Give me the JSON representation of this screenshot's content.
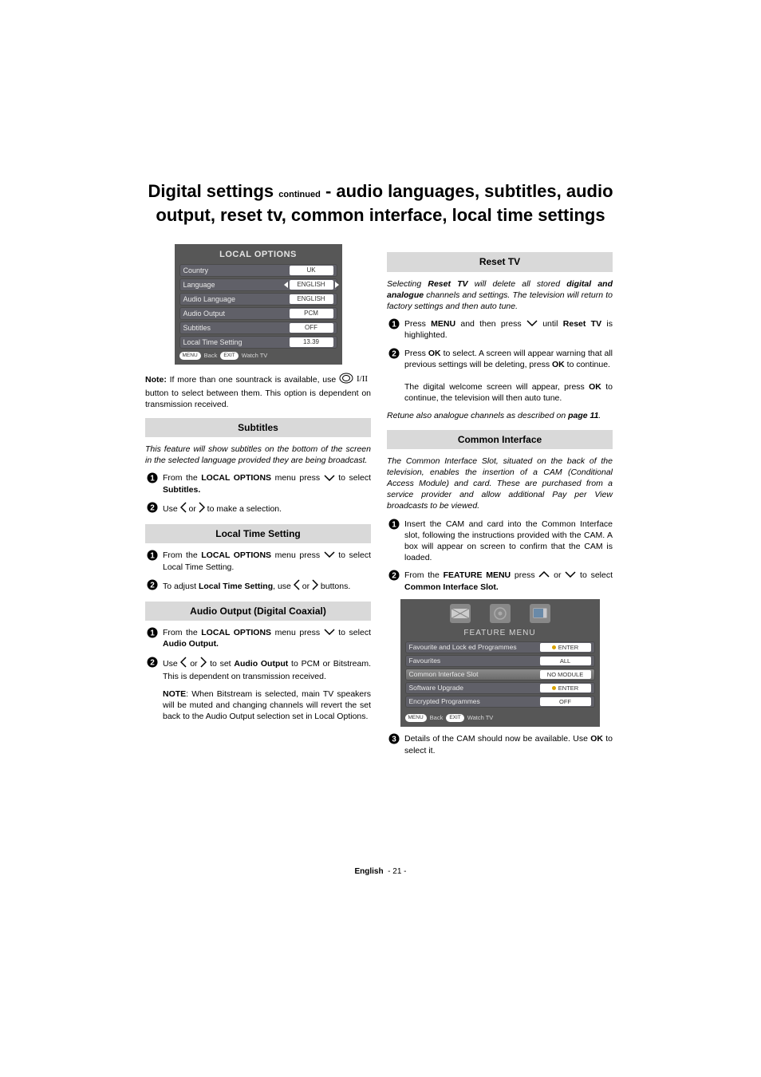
{
  "title_part1": "Digital settings",
  "title_cont": "continued",
  "title_part2": " - audio languages, subtitles, audio output, reset tv, common interface, local time settings",
  "local_options": {
    "title": "LOCAL OPTIONS",
    "rows": [
      {
        "label": "Country",
        "value": "UK"
      },
      {
        "label": "Language",
        "value": "ENGLISH",
        "selected": true
      },
      {
        "label": "Audio Language",
        "value": "ENGLISH"
      },
      {
        "label": "Audio Output",
        "value": "PCM"
      },
      {
        "label": "Subtitles",
        "value": "OFF"
      },
      {
        "label": "Local Time Setting",
        "value": "13.39"
      }
    ],
    "footer_menu": "MENU",
    "footer_back": "Back",
    "footer_exit": "EXIT",
    "footer_watch": "Watch TV"
  },
  "note1_prefix": "Note:",
  "note1_a": " If more than one sountrack is available, use ",
  "note1_b": " button to select between them. This option is dependent on transmission received.",
  "subtitles": {
    "heading": "Subtitles",
    "intro": "This feature will show subtitles on the bottom of the screen in the selected language provided they are being broadcast.",
    "step1_a": "From the ",
    "step1_b": "LOCAL OPTIONS",
    "step1_c": " menu press ",
    "step1_d": " to select ",
    "step1_e": "Subtitles.",
    "step2_a": "Use ",
    "step2_b": " or ",
    "step2_c": " to make a selection."
  },
  "localtime": {
    "heading": "Local Time Setting",
    "step1_a": "From the ",
    "step1_b": "LOCAL OPTIONS",
    "step1_c": " menu press ",
    "step1_d": " to select Local Time Setting.",
    "step2_a": "To adjust ",
    "step2_b": "Local Time Setting",
    "step2_c": ", use ",
    "step2_d": " or ",
    "step2_e": " buttons."
  },
  "audioout": {
    "heading": "Audio Output (Digital Coaxial)",
    "step1_a": "From the ",
    "step1_b": "LOCAL OPTIONS",
    "step1_c": " menu press ",
    "step1_d": " to select ",
    "step1_e": "Audio Output.",
    "step2_a": "Use ",
    "step2_b": " or ",
    "step2_c": " to set ",
    "step2_d": "Audio Output",
    "step2_e": " to PCM or Bitstream. This is dependent on transmission received.",
    "note_prefix": "NOTE",
    "note_body": ": When Bitstream is selected, main TV speakers will be muted and changing channels will revert the set back to the Audio Output selection set in Local Options."
  },
  "reset": {
    "heading": "Reset TV",
    "intro_a": "Selecting ",
    "intro_b": "Reset TV",
    "intro_c": " will delete all stored ",
    "intro_d": "digital and analogue",
    "intro_e": " channels and settings. The television will return to factory settings and then auto tune.",
    "step1_a": "Press ",
    "step1_b": "MENU",
    "step1_c": " and then press ",
    "step1_d": " until ",
    "step1_e": "Reset TV",
    "step1_f": " is highlighted.",
    "step2_a": "Press ",
    "step2_b": "OK",
    "step2_c": " to select. A screen will appear warning that all previous settings will be deleting, press ",
    "step2_d": "OK",
    "step2_e": " to continue.",
    "step2_f": "The digital welcome screen will appear, press ",
    "step2_g": "OK",
    "step2_h": " to continue, the television will then auto tune.",
    "retune_a": "Retune also analogue channels as described on ",
    "retune_b": "page 11",
    "retune_c": "."
  },
  "ci": {
    "heading": "Common Interface",
    "intro": "The Common Interface Slot, situated on the back of the television, enables the insertion of a CAM (Conditional Access Module) and card. These are purchased from a service provider and allow additional Pay per View broadcasts to be viewed.",
    "step1": "Insert the CAM and card into the Common Interface slot, following the instructions provided with the CAM. A box will appear on screen to confirm that the CAM is loaded.",
    "step2_a": "From the ",
    "step2_b": "FEATURE MENU",
    "step2_c": " press ",
    "step2_d": " or ",
    "step2_e": " to select ",
    "step2_f": "Common Interface Slot.",
    "step3_a": "Details of the CAM should now be available. Use ",
    "step3_b": "OK",
    "step3_c": " to select it."
  },
  "feature_menu": {
    "title": "FEATURE MENU",
    "rows": [
      {
        "label": "Favourite and Lock ed Programmes",
        "value": "ENTER",
        "dot": true
      },
      {
        "label": "Favourites",
        "value": "ALL"
      },
      {
        "label": "Common Interface Slot",
        "value": "NO MODULE",
        "highlight": true
      },
      {
        "label": "Software Upgrade",
        "value": "ENTER",
        "dot": true
      },
      {
        "label": "Encrypted Programmes",
        "value": "OFF"
      }
    ],
    "footer_menu": "MENU",
    "footer_back": "Back",
    "footer_exit": "EXIT",
    "footer_watch": "Watch TV"
  },
  "footer_lang": "English",
  "footer_page": "- 21 -"
}
